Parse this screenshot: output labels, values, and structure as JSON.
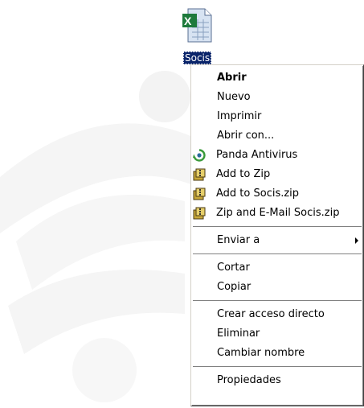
{
  "desktop": {
    "file_name": "Socis"
  },
  "context_menu": {
    "items": [
      {
        "label": "Abrir",
        "bold": true
      },
      {
        "label": "Nuevo"
      },
      {
        "label": "Imprimir"
      },
      {
        "label": "Abrir con..."
      },
      {
        "label": "Panda Antivirus",
        "icon": "panda-antivirus-icon"
      },
      {
        "label": "Add to Zip",
        "icon": "winzip-icon"
      },
      {
        "label": "Add to Socis.zip",
        "icon": "winzip-icon"
      },
      {
        "label": "Zip and E-Mail Socis.zip",
        "icon": "winzip-icon"
      },
      {
        "label": "Enviar a",
        "submenu": true
      },
      {
        "label": "Cortar"
      },
      {
        "label": "Copiar"
      },
      {
        "label": "Crear acceso directo"
      },
      {
        "label": "Eliminar"
      },
      {
        "label": "Cambiar nombre"
      },
      {
        "label": "Propiedades"
      }
    ]
  },
  "colors": {
    "selection": "#0a246a",
    "excel_green": "#1e7a3c",
    "panda_green": "#3a9a3a"
  }
}
